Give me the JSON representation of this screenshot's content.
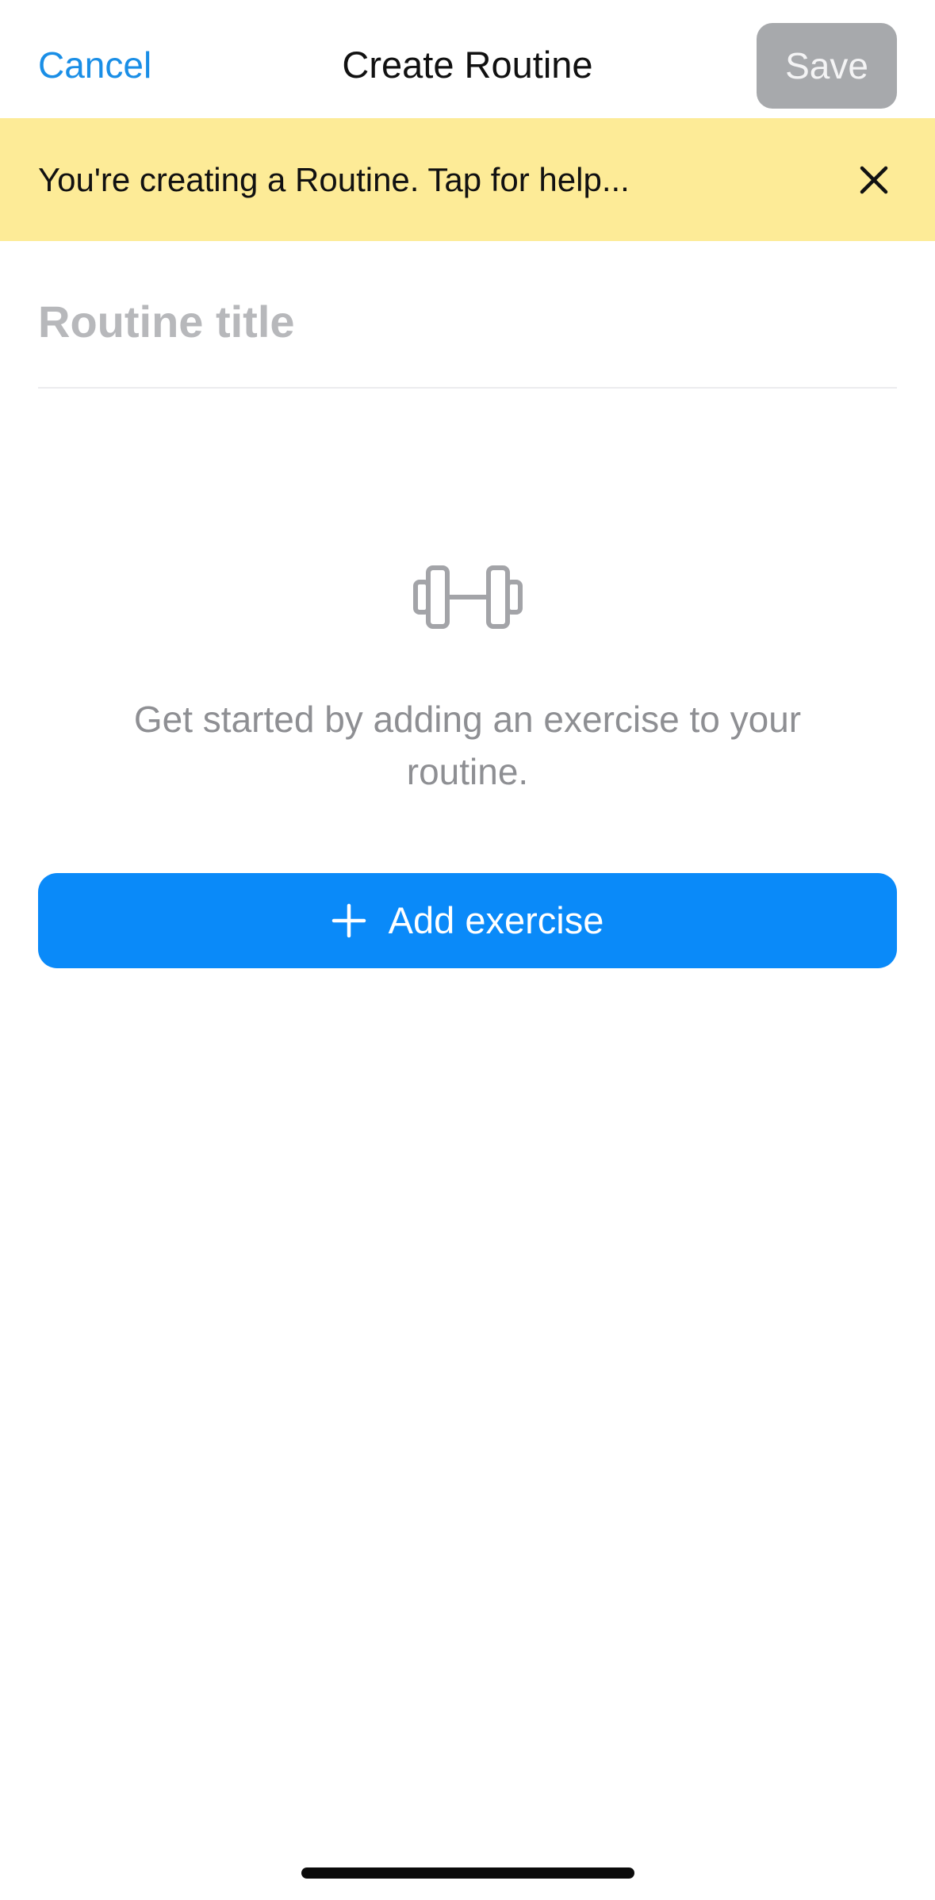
{
  "nav": {
    "cancel_label": "Cancel",
    "title": "Create Routine",
    "save_label": "Save"
  },
  "banner": {
    "text": "You're creating a Routine. Tap for help...",
    "close_icon": "close-icon"
  },
  "form": {
    "title_placeholder": "Routine title",
    "title_value": ""
  },
  "empty_state": {
    "icon": "dumbbell-icon",
    "message": "Get started by adding an exercise to your routine."
  },
  "add_exercise": {
    "icon": "plus-icon",
    "label": "Add exercise"
  },
  "colors": {
    "accent": "#0a8af9",
    "link": "#1a8ee6",
    "banner_bg": "#fdeb97",
    "save_disabled_bg": "#a7a9ac",
    "muted_text": "#8e8f93"
  }
}
